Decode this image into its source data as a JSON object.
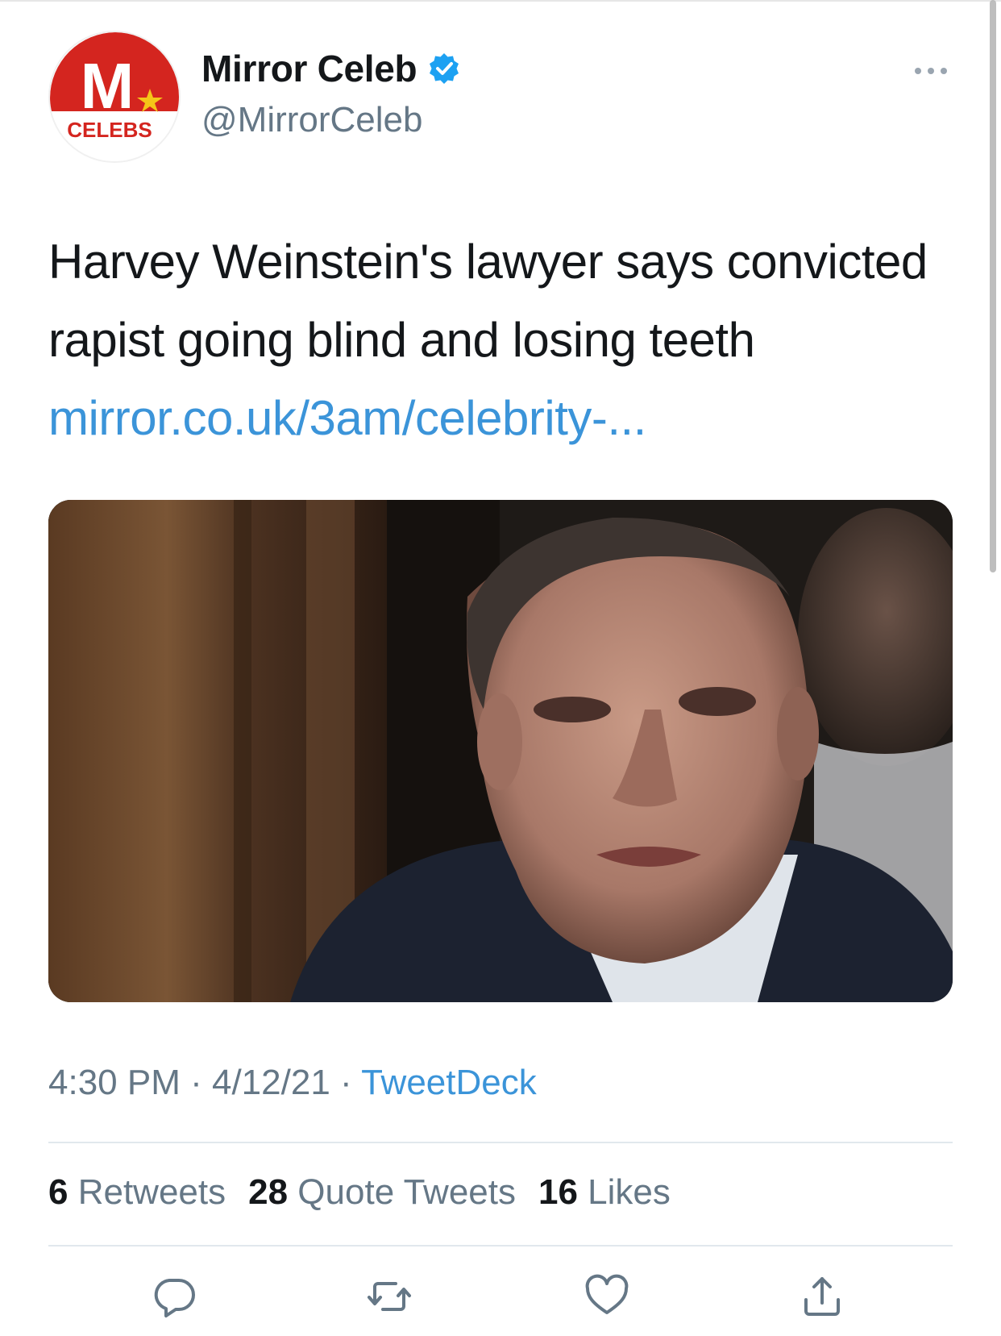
{
  "account": {
    "display_name": "Mirror Celeb",
    "handle": "@MirrorCeleb",
    "avatar": {
      "letter": "M",
      "label": "CELEBS",
      "icon": "mirror-celebs-logo"
    }
  },
  "tweet": {
    "text": "Harvey Weinstein's lawyer says convicted rapist going blind and losing teeth ",
    "link": "mirror.co.uk/3am/celebrity-..."
  },
  "meta": {
    "time": "4:30 PM",
    "sep1": " · ",
    "date": "4/12/21",
    "sep2": " · ",
    "source": "TweetDeck"
  },
  "stats": [
    {
      "count": "6",
      "label": " Retweets"
    },
    {
      "count": "28",
      "label": " Quote Tweets"
    },
    {
      "count": "16",
      "label": " Likes"
    }
  ],
  "actions": [
    "reply-icon",
    "retweet-icon",
    "like-icon",
    "share-icon"
  ],
  "colors": {
    "link": "#3b94d9",
    "muted": "#657786",
    "brand_red": "#d4251f",
    "verified": "#1da1f2"
  }
}
